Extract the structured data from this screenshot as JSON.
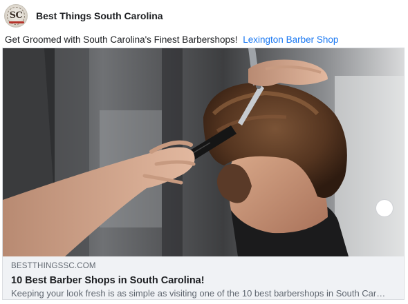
{
  "post": {
    "page_name": "Best Things South Carolina",
    "avatar_text": "SC",
    "message": "Get Groomed with South Carolina's Finest Barbershops!",
    "message_link": "Lexington Barber Shop"
  },
  "link_card": {
    "image_icon": "barber-haircut-photo",
    "domain": "BESTTHINGSSC.COM",
    "title": "10 Best Barber Shops in South Carolina!",
    "description": "Keeping your look fresh is as simple as visiting one of the 10 best barbershops in South Caroli..."
  },
  "colors": {
    "link": "#1877f2",
    "card_background": "#f0f2f5",
    "secondary_text": "#606770"
  }
}
